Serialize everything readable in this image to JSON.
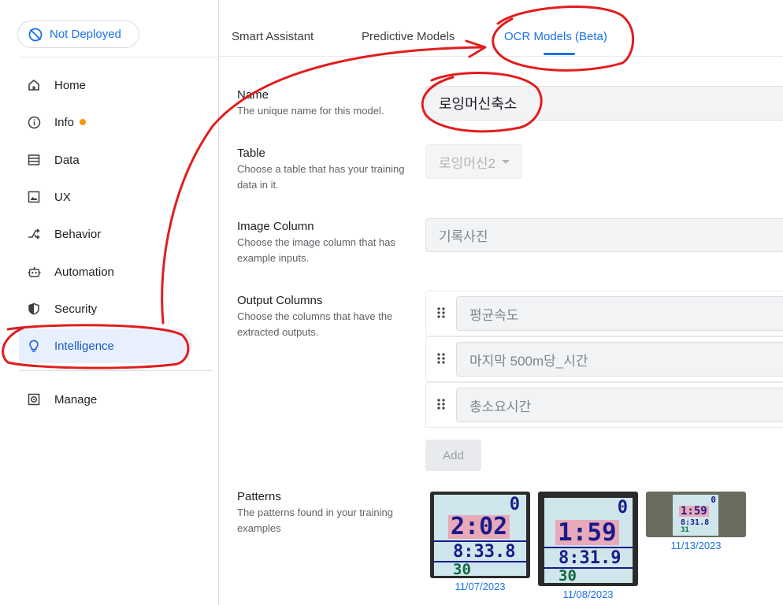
{
  "deploy": {
    "label": "Not Deployed"
  },
  "sidebar": {
    "items": [
      {
        "label": "Home",
        "icon": "home-icon"
      },
      {
        "label": "Info",
        "icon": "info-icon"
      },
      {
        "label": "Data",
        "icon": "data-icon"
      },
      {
        "label": "UX",
        "icon": "image-icon"
      },
      {
        "label": "Behavior",
        "icon": "shuffle-icon"
      },
      {
        "label": "Automation",
        "icon": "robot-icon"
      },
      {
        "label": "Security",
        "icon": "shield-icon"
      },
      {
        "label": "Intelligence",
        "icon": "lightbulb-icon"
      },
      {
        "label": "Manage",
        "icon": "gear-icon"
      }
    ],
    "active": "Intelligence",
    "info_badge_color": "#f29900"
  },
  "tabs": [
    {
      "label": "Smart Assistant"
    },
    {
      "label": "Predictive Models"
    },
    {
      "label": "OCR Models (Beta)"
    }
  ],
  "form": {
    "name": {
      "title": "Name",
      "desc": "The unique name for this model.",
      "value": "로잉머신축소"
    },
    "table": {
      "title": "Table",
      "desc": "Choose a table that has your training data in it.",
      "value": "로잉머신2"
    },
    "image_column": {
      "title": "Image Column",
      "desc": "Choose the image column that has example inputs.",
      "value": "기록사진"
    },
    "output_columns": {
      "title": "Output Columns",
      "desc": "Choose the columns that have the extracted outputs.",
      "items": [
        "평균속도",
        "마지막 500m당_시간",
        "총소요시간"
      ]
    },
    "add_label": "Add",
    "patterns": {
      "title": "Patterns",
      "desc": "The patterns found in your training examples",
      "items": [
        {
          "date": "11/07/2023",
          "zero": "0",
          "big": "2:02",
          "mid": "8:33.8",
          "sml": "30"
        },
        {
          "date": "11/08/2023",
          "zero": "0",
          "big": "1:59",
          "mid": "8:31.9",
          "sml": "30"
        },
        {
          "date": "11/13/2023",
          "zero": "0",
          "big": "1:59",
          "mid": "8:31.8",
          "sml": "31"
        }
      ]
    }
  },
  "colors": {
    "accent": "#1a73e8",
    "annotation": "#e01e1e"
  }
}
